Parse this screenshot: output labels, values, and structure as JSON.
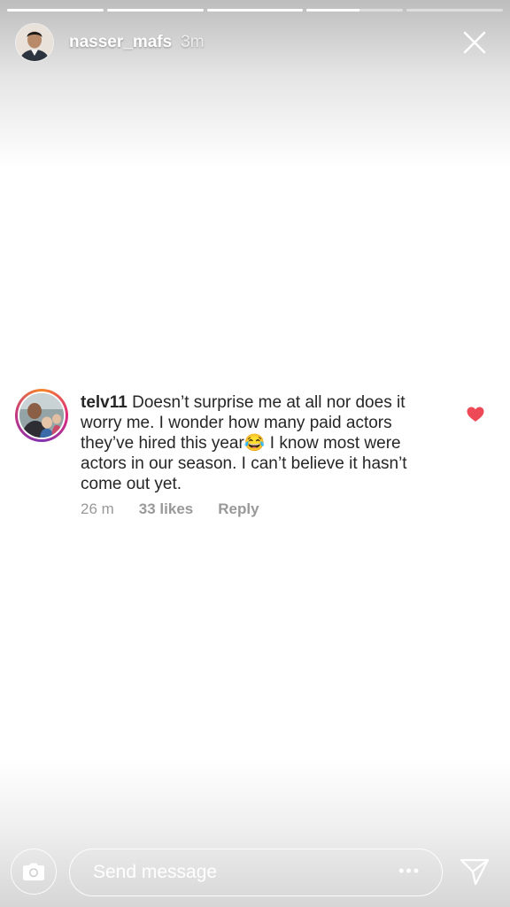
{
  "story": {
    "progress": [
      1,
      1,
      1,
      0.55,
      0
    ],
    "username": "nasser_mafs",
    "timestamp": "3m"
  },
  "comment": {
    "username": "telv11",
    "text_part1": "Doesn’t surprise me at all nor does it worry me. I wonder how many paid actors they’ve hired this year",
    "emoji": "😂",
    "text_part2": " I know most were actors in our season. I can’t believe it hasn’t come out yet.",
    "time": "26 m",
    "likes": "33 likes",
    "reply_label": "Reply",
    "liked": true,
    "heart_color": "#ed4956"
  },
  "composer": {
    "placeholder": "Send message",
    "more_label": "•••"
  },
  "icons": {
    "close": "close-icon",
    "heart": "heart-icon",
    "camera": "camera-icon",
    "send": "send-icon"
  }
}
